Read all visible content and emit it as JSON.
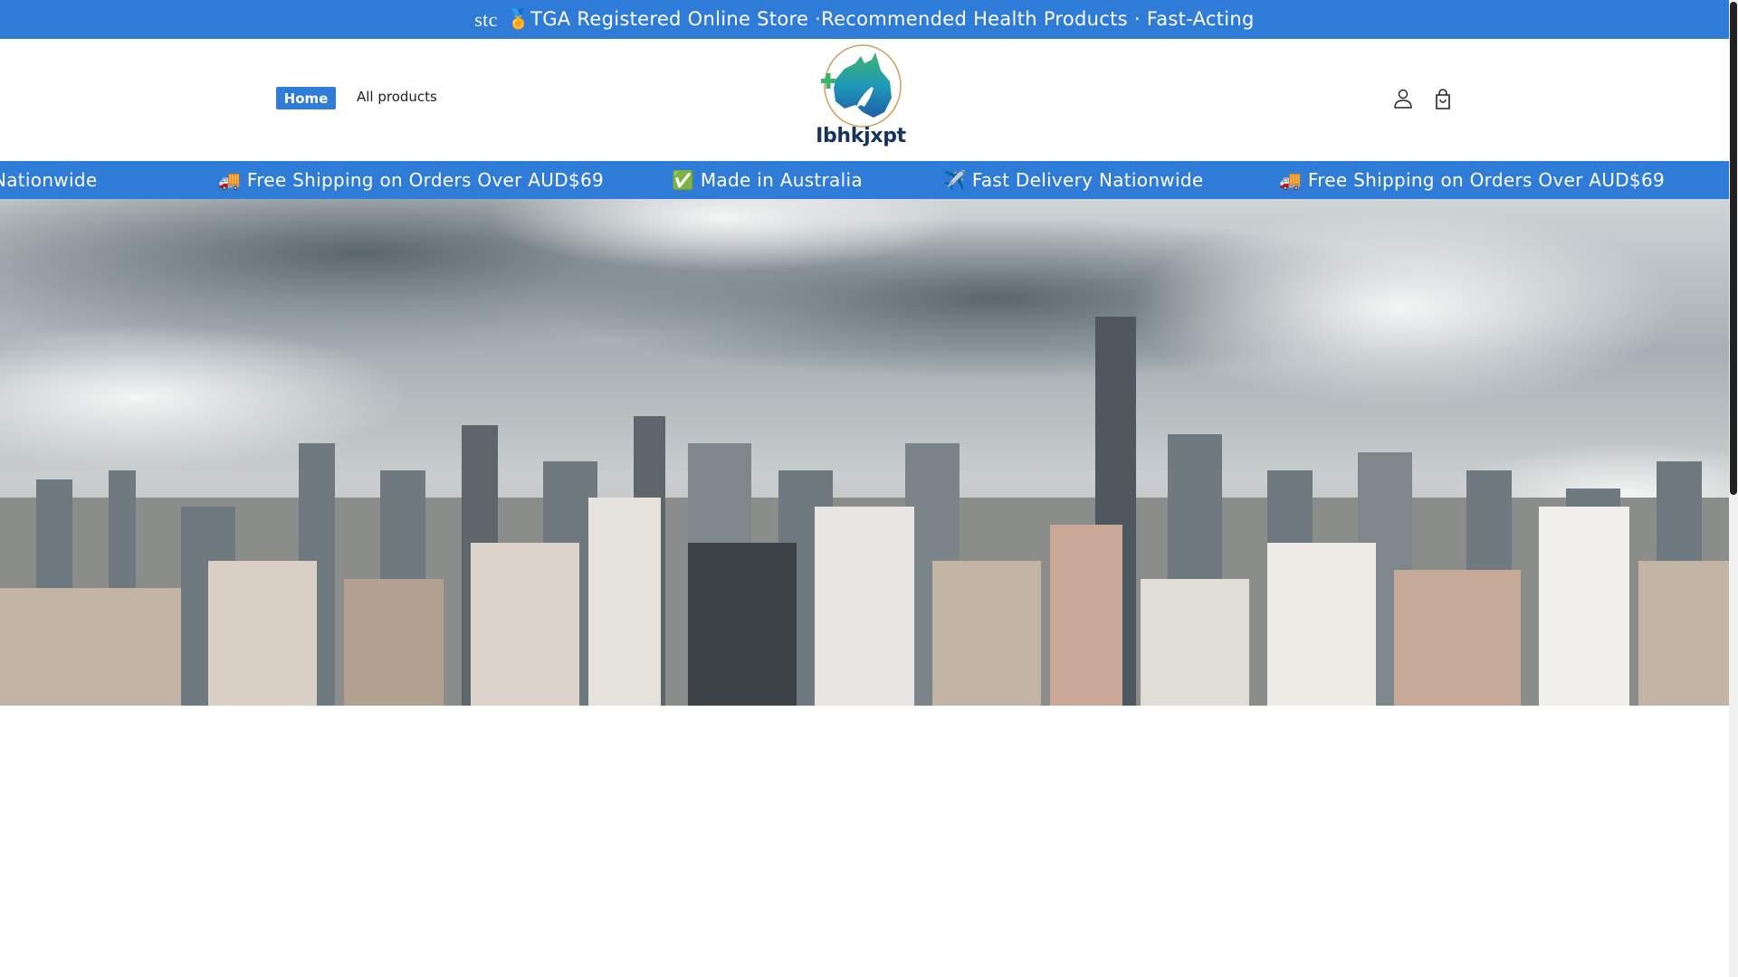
{
  "announcement": {
    "prefix": "stc",
    "icon": "medal-icon",
    "text": "🏅TGA Registered Online Store ·Recommended Health Products · Fast-Acting"
  },
  "nav": {
    "home": "Home",
    "all_products": "All products"
  },
  "brand": {
    "name": "Ibhkjxpt"
  },
  "ticker": {
    "items": [
      "✈️ Fast Delivery Nationwide",
      "🚚 Free Shipping on Orders Over AUD$69",
      "✅ Made in Australia",
      "✈️ Fast Delivery Nationwide",
      "🚚 Free Shipping on Orders Over AUD$69"
    ]
  },
  "colors": {
    "accent": "#2f7bd8",
    "logo_text": "#16335e"
  }
}
